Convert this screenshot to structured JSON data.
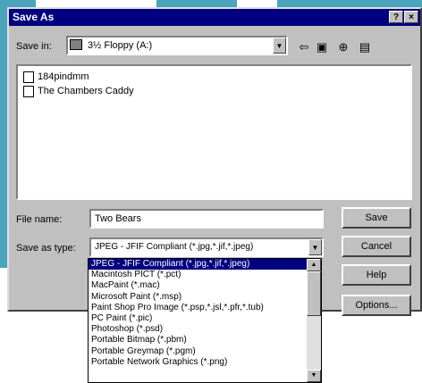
{
  "window": {
    "title": "Save As",
    "help_btn": "?",
    "close_btn": "×"
  },
  "save_in": {
    "label": "Save in:",
    "value": "3½ Floppy (A:)"
  },
  "files": [
    "184pindmm",
    "The Chambers Caddy"
  ],
  "file_name": {
    "label": "File name:",
    "value": "Two Bears"
  },
  "save_as_type": {
    "label": "Save as type:",
    "value": "JPEG - JFIF Compliant (*.jpg,*.jif,*.jpeg)"
  },
  "type_options": [
    "JPEG - JFIF Compliant (*.jpg,*.jif,*.jpeg)",
    "Macintosh PICT (*.pct)",
    "MacPaint (*.mac)",
    "Microsoft Paint (*.msp)",
    "Paint Shop Pro Image (*.psp,*.jsl,*.pfr,*.tub)",
    "PC Paint (*.pic)",
    "Photoshop (*.psd)",
    "Portable Bitmap (*.pbm)",
    "Portable Greymap (*.pgm)",
    "Portable Network Graphics (*.png)"
  ],
  "buttons": {
    "save": "Save",
    "cancel": "Cancel",
    "help": "Help",
    "options": "Options..."
  },
  "icons": {
    "folder": "floppy-icon",
    "back": "⇦",
    "up": "▣",
    "new_folder": "⊕",
    "view": "▤"
  }
}
